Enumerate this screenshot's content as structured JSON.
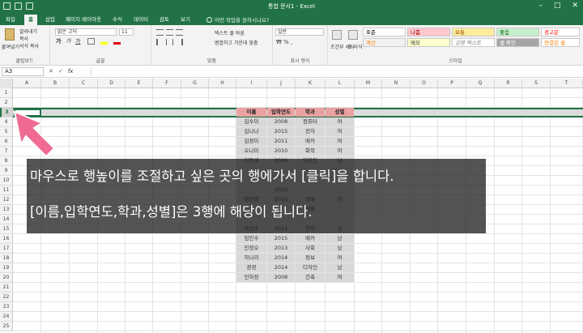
{
  "window": {
    "title": "통합 문서1 - Excel",
    "qat_icons": [
      "save-icon",
      "undo-icon",
      "redo-icon",
      "customize-icon"
    ],
    "controls": [
      "minimize-icon",
      "maximize-icon",
      "close-icon"
    ]
  },
  "tabs": [
    {
      "label": "파일",
      "active": false
    },
    {
      "label": "홈",
      "active": true
    },
    {
      "label": "삽입",
      "active": false
    },
    {
      "label": "페이지 레이아웃",
      "active": false
    },
    {
      "label": "수식",
      "active": false
    },
    {
      "label": "데이터",
      "active": false
    },
    {
      "label": "검토",
      "active": false
    },
    {
      "label": "보기",
      "active": false
    }
  ],
  "tellme": "어떤 작업을 원하시나요?",
  "ribbon": {
    "clipboard": {
      "label": "클립보드",
      "paste": "붙여넣기",
      "cut": "잘라내기",
      "copy": "복사",
      "format_painter": "서식 복사"
    },
    "font": {
      "label": "글꼴",
      "name": "맑은 고딕",
      "size": "11",
      "bold": "가",
      "italic": "가",
      "underline": "가"
    },
    "alignment": {
      "label": "맞춤",
      "wrap": "텍스트 줄 바꿈",
      "merge": "병합하고 가운데 맞춤"
    },
    "number": {
      "label": "표시 형식",
      "format": "일반"
    },
    "styles": {
      "label": "스타일",
      "conditional": "조건부 서식",
      "table": "표 서식",
      "cells": [
        {
          "label": "표준",
          "bg": "#ffffff",
          "fg": "#000000"
        },
        {
          "label": "나쁨",
          "bg": "#ffc7ce",
          "fg": "#9c0006"
        },
        {
          "label": "보통",
          "bg": "#ffeb9c",
          "fg": "#9c5700"
        },
        {
          "label": "좋음",
          "bg": "#c6efce",
          "fg": "#006100"
        },
        {
          "label": "경고문",
          "bg": "#ffffff",
          "fg": "#ff0000"
        },
        {
          "label": "계산",
          "bg": "#f2f2f2",
          "fg": "#fa7d00"
        },
        {
          "label": "메모",
          "bg": "#ffffcc",
          "fg": "#333333"
        },
        {
          "label": "설명 텍스트",
          "bg": "#ffffff",
          "fg": "#7f7f7f"
        },
        {
          "label": "셀 확인",
          "bg": "#a5a5a5",
          "fg": "#ffffff"
        },
        {
          "label": "연결된 셀",
          "bg": "#ffffff",
          "fg": "#fa7d00"
        }
      ]
    }
  },
  "formula_bar": {
    "name_box": "A3",
    "fx": "fx",
    "value": ""
  },
  "columns": [
    "A",
    "B",
    "C",
    "D",
    "E",
    "F",
    "G",
    "H",
    "I",
    "J",
    "K",
    "L",
    "M",
    "N",
    "O",
    "P",
    "Q",
    "R",
    "S",
    "T"
  ],
  "rows": [
    "1",
    "2",
    "3",
    "4",
    "5",
    "6",
    "7",
    "8",
    "9",
    "10",
    "11",
    "12",
    "13",
    "14",
    "15",
    "16",
    "17",
    "18",
    "19",
    "20",
    "21",
    "22",
    "23",
    "24",
    "25"
  ],
  "table": {
    "headers": [
      "이름",
      "입학연도",
      "학과",
      "성별"
    ],
    "rows": [
      [
        "김수미",
        "2008",
        "컴퓨터",
        "여"
      ],
      [
        "김나나",
        "2015",
        "전자",
        "여"
      ],
      [
        "김정미",
        "2011",
        "메카",
        "여"
      ],
      [
        "오나미",
        "2010",
        "화학",
        "여"
      ],
      [
        "기득세",
        "2009",
        "디자인",
        "남"
      ],
      [
        "",
        "",
        "",
        ""
      ],
      [
        "",
        "",
        "",
        ""
      ],
      [
        "",
        "2018",
        "",
        ""
      ],
      [
        "정진영",
        "2018",
        "경제",
        "여"
      ],
      [
        "",
        "",
        "경영",
        ""
      ],
      [
        "",
        "",
        "",
        ""
      ],
      [
        "박진수",
        "2011",
        "전자",
        "남"
      ],
      [
        "임민수",
        "2015",
        "메카",
        "남"
      ],
      [
        "민정오",
        "2013",
        "사회",
        "남"
      ],
      [
        "하나리",
        "2014",
        "정보",
        "여"
      ],
      [
        "권정",
        "2014",
        "디자인",
        "남"
      ],
      [
        "민하정",
        "2008",
        "건축",
        "여"
      ]
    ]
  },
  "overlay": {
    "line1": "마우스로 행높이를 조절하고 싶은 곳의 행에가서 [클릭]을 합니다.",
    "line2": "[이름,입학연도,학과,성별]은 3행에 해당이 됩니다."
  }
}
